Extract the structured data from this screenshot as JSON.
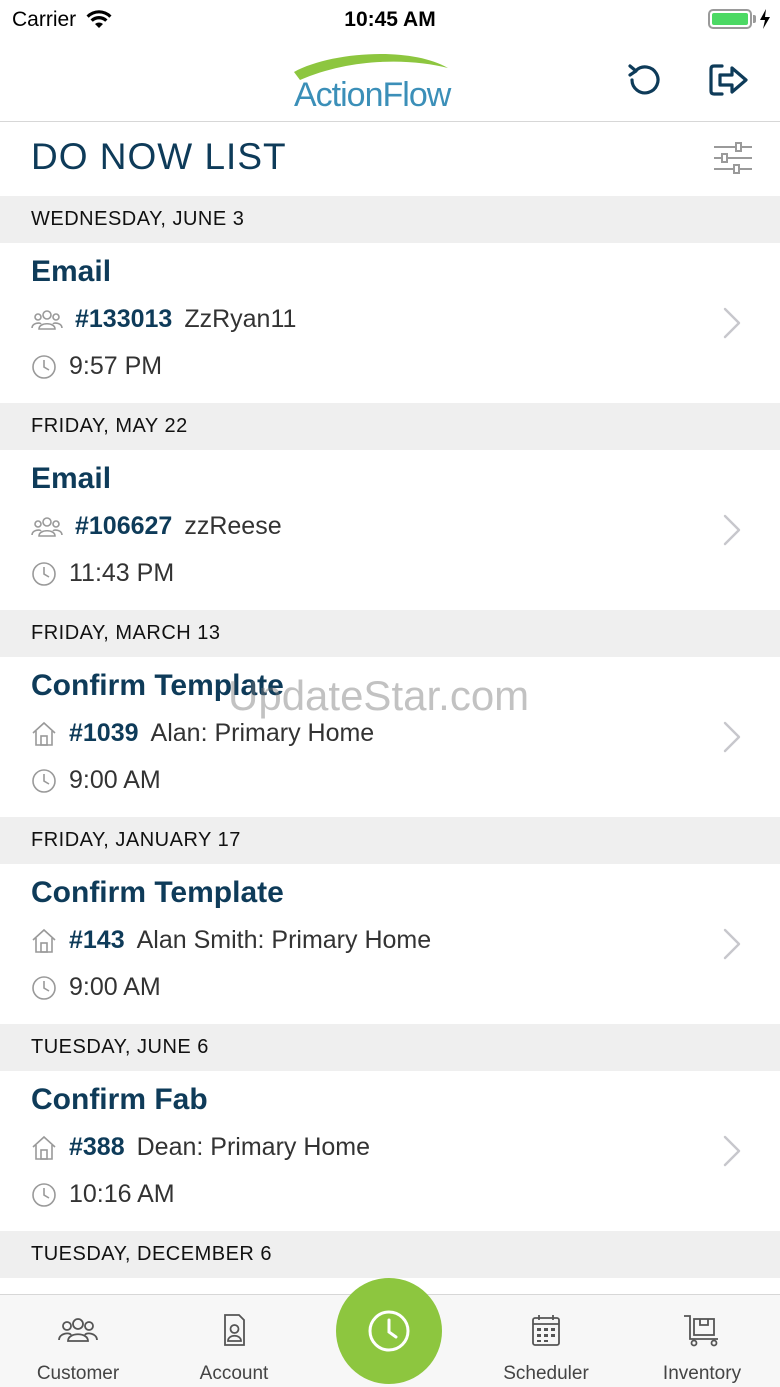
{
  "status_bar": {
    "carrier": "Carrier",
    "time": "10:45 AM"
  },
  "header": {
    "logo_text": "ActionFlow"
  },
  "page": {
    "title": "DO NOW LIST"
  },
  "groups": [
    {
      "date": "WEDNESDAY, JUNE 3",
      "title": "Email",
      "type_icon": "people-icon",
      "ref": "#133013",
      "name": "ZzRyan11",
      "time": "9:57 PM"
    },
    {
      "date": "FRIDAY, MAY 22",
      "title": "Email",
      "type_icon": "people-icon",
      "ref": "#106627",
      "name": "zzReese",
      "time": "11:43 PM"
    },
    {
      "date": "FRIDAY, MARCH 13",
      "title": "Confirm Template",
      "type_icon": "home-icon",
      "ref": "#1039",
      "name": "Alan: Primary Home",
      "time": "9:00 AM"
    },
    {
      "date": "FRIDAY, JANUARY 17",
      "title": "Confirm Template",
      "type_icon": "home-icon",
      "ref": "#143",
      "name": "Alan Smith: Primary Home",
      "time": "9:00 AM"
    },
    {
      "date": "TUESDAY, JUNE 6",
      "title": "Confirm Fab",
      "type_icon": "home-icon",
      "ref": "#388",
      "name": "Dean: Primary Home",
      "time": "10:16 AM"
    },
    {
      "date": "TUESDAY, DECEMBER 6"
    }
  ],
  "watermark": "UpdateStar.com",
  "tabs": [
    {
      "label": "Customer",
      "icon": "people-icon"
    },
    {
      "label": "Account",
      "icon": "account-icon"
    },
    {
      "label": "",
      "icon": "clock-icon"
    },
    {
      "label": "Scheduler",
      "icon": "calendar-icon"
    },
    {
      "label": "Inventory",
      "icon": "cart-icon"
    }
  ],
  "colors": {
    "brand_navy": "#0e3b59",
    "brand_blue": "#3b8fb8",
    "accent_green": "#8dc63f"
  }
}
